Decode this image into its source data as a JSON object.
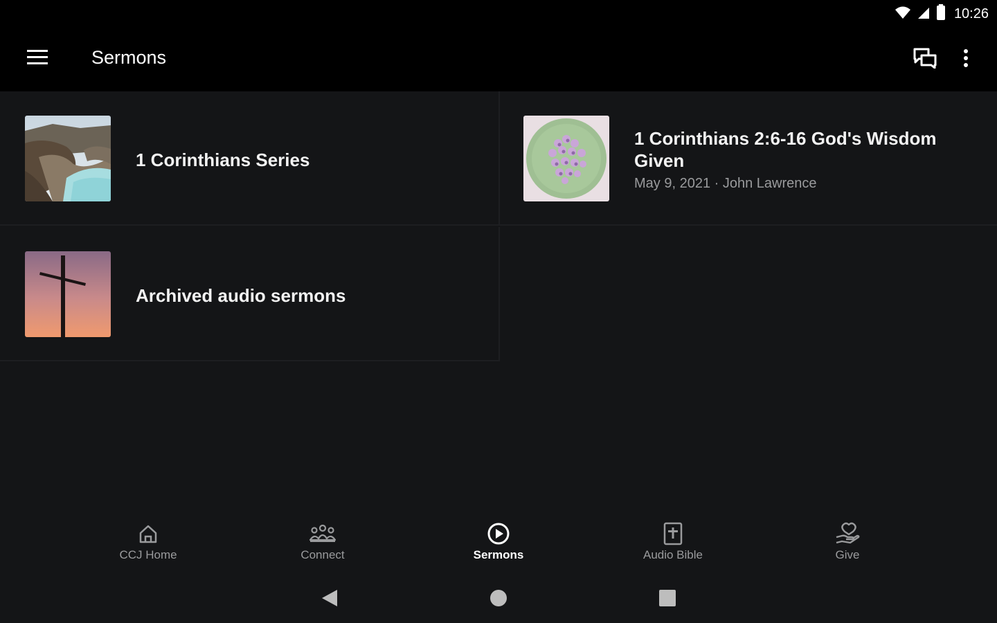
{
  "status_bar": {
    "time": "10:26",
    "icons": [
      "wifi-icon",
      "signal-icon",
      "battery-icon"
    ]
  },
  "app_bar": {
    "title": "Sermons",
    "menu_icon": "hamburger-menu-icon",
    "actions": [
      "chat-icon",
      "more-vert-icon"
    ]
  },
  "items": [
    {
      "title": "1 Corinthians Series",
      "subtitle": "",
      "thumbnail": "coastal-landscape"
    },
    {
      "title": "1 Corinthians 2:6-16   God's Wisdom Given",
      "title_line1": "1 Corinthians 2:6-16   God's Wisdom",
      "title_line2": "Given",
      "subtitle": "May 9, 2021 · John Lawrence",
      "thumbnail": "flower-bouquet"
    },
    {
      "title": "Archived audio sermons",
      "subtitle": "",
      "thumbnail": "cross-silhouette"
    }
  ],
  "bottom_nav": [
    {
      "label": "CCJ Home",
      "icon": "home-icon",
      "active": false
    },
    {
      "label": "Connect",
      "icon": "group-icon",
      "active": false
    },
    {
      "label": "Sermons",
      "icon": "play-circle-icon",
      "active": true
    },
    {
      "label": "Audio Bible",
      "icon": "bible-icon",
      "active": false
    },
    {
      "label": "Give",
      "icon": "give-hand-icon",
      "active": false
    }
  ],
  "system_nav": [
    "back-icon",
    "home-circle-icon",
    "recents-icon"
  ],
  "colors": {
    "background": "#141517",
    "bar": "#000000",
    "text_primary": "#ffffff",
    "text_secondary": "#9a9b9d",
    "divider": "#1d1e21"
  }
}
